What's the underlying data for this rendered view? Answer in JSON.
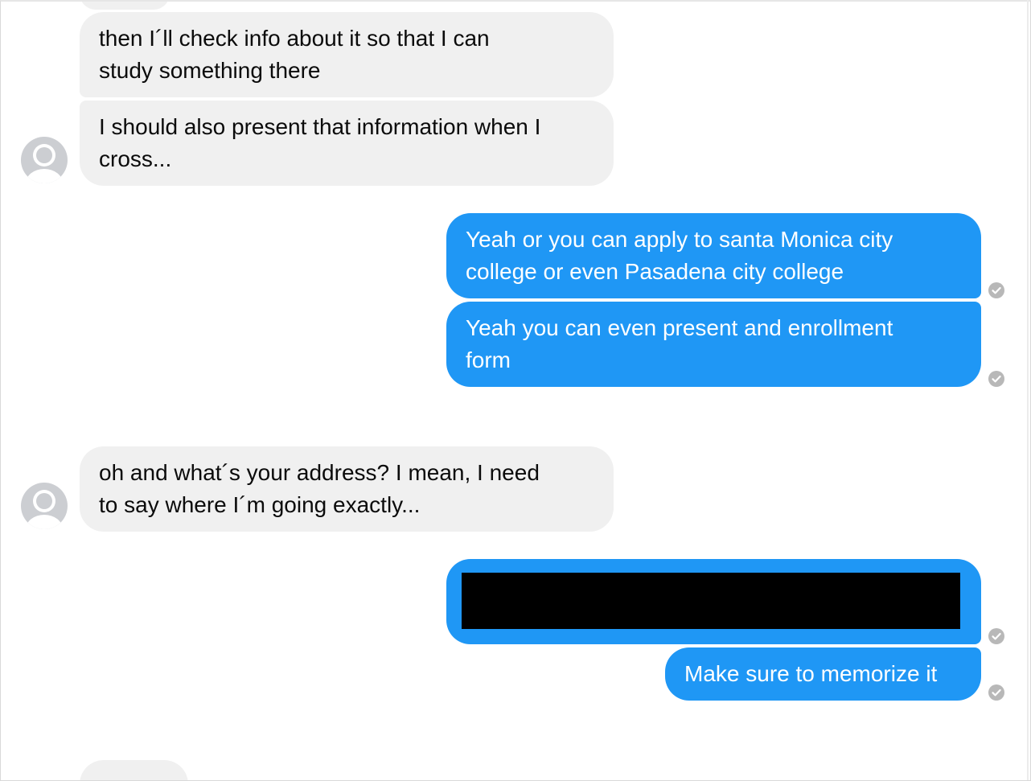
{
  "conversation": {
    "messages": [
      {
        "sender": "them",
        "text": "then I´ll check info about it so that I can\nstudy something there"
      },
      {
        "sender": "them",
        "text": "I should also present that information when I\ncross..."
      },
      {
        "sender": "me",
        "text": "Yeah or you can apply to santa Monica city\ncollege or even Pasadena city college",
        "status": "sent"
      },
      {
        "sender": "me",
        "text": "Yeah you can even present and enrollment\nform",
        "status": "sent"
      },
      {
        "sender": "them",
        "text": "oh and what´s your address? I mean, I need\nto say where I´m going exactly..."
      },
      {
        "sender": "me",
        "text": "",
        "redacted": true,
        "status": "sent"
      },
      {
        "sender": "me",
        "text": "Make sure to memorize it",
        "status": "sent"
      }
    ]
  },
  "icons": {
    "avatar": "default-profile-avatar-icon",
    "status": "sent-check-circle-icon"
  },
  "colors": {
    "incoming_bubble": "#f0f0f0",
    "outgoing_bubble": "#1f97f5",
    "outgoing_text": "#ffffff",
    "incoming_text": "#0b0b0b",
    "status_icon": "#b8b8b8",
    "avatar": "#ccced2"
  }
}
